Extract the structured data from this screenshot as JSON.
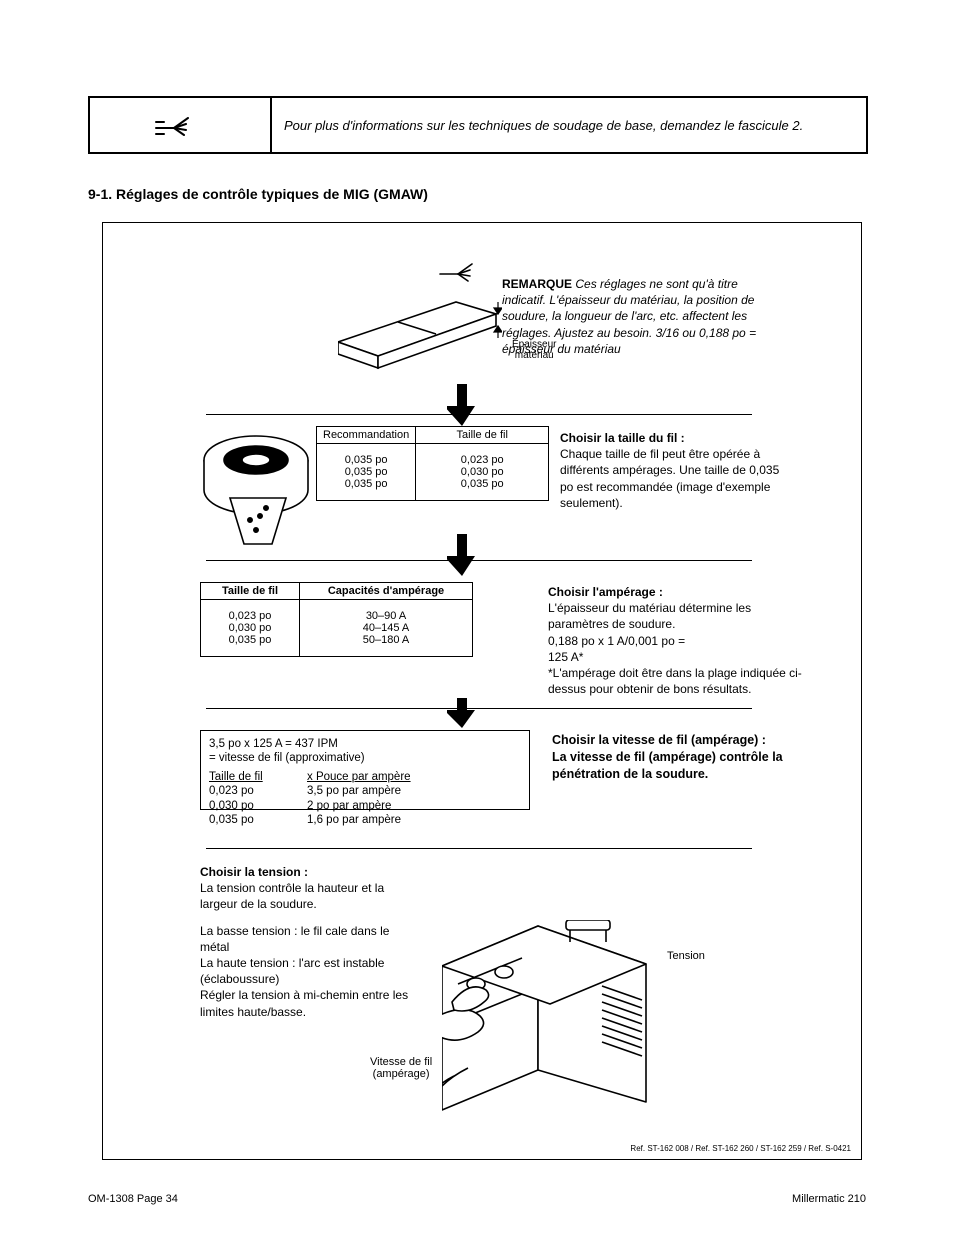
{
  "hint": {
    "hand_icon": "pointing-hand-icon",
    "text": "Pour plus d'informations sur les techniques de soudage de base, demandez le fascicule 2."
  },
  "section_title": "9-1. Réglages de contrôle typiques de MIG (GMAW)",
  "step1": {
    "note_title": "REMARQUE",
    "note_body": "Ces réglages ne sont qu'à titre indicatif. L'épaisseur du matériau, la position de soudure, la longueur de l'arc, etc. affectent les réglages. Ajustez au besoin. 3/16 ou 0,188 po = épaisseur du matériau",
    "label_thickness": "Épaisseur\nmatériau"
  },
  "step2": {
    "table": {
      "col1_header": "Recommandation",
      "col2_header": "Taille de fil",
      "col1_rows": [
        "0,035 po",
        "0,035 po",
        "0,035 po"
      ],
      "col2_rows": [
        "0,023 po",
        "0,030 po",
        "0,035 po"
      ]
    },
    "text_title": "Choisir la taille du fil   :",
    "text_body": "Chaque taille de fil peut être opérée à différents ampérages. Une taille de 0,035 po est recommandée (image d'exemple seulement)."
  },
  "step3": {
    "table": {
      "col1_header": "Taille de fil",
      "col2_header": "Capacités d'ampérage",
      "col1_rows": [
        "0,023 po",
        "0,030 po",
        "0,035 po"
      ],
      "col2_rows": [
        "30–90 A",
        "40–145 A",
        "50–180 A"
      ]
    },
    "text_title": "Choisir l'ampérage   :",
    "text_body": "L'épaisseur du matériau détermine les paramètres de soudure.\n0,188 po    x 1 A/0,001 po =\n125 A*\n*L'ampérage doit être dans la plage indiquée ci-dessus pour obtenir de bons résultats."
  },
  "step4": {
    "box_line1": "3,5 po x 125 A = 437 IPM",
    "box_line2": "= vitesse de fil (approximative)",
    "box_line3_label": "Taille de fil",
    "box_line3_r1": "0,023 po",
    "box_line3_r2": "0,030 po",
    "box_line3_r3": "0,035 po",
    "box_line4_label": "x Pouce par ampère",
    "box_line4_r1": "3,5 po par ampère",
    "box_line4_r2": "2 po par ampère",
    "box_line4_r3": "1,6 po par ampère",
    "text": "Choisir la vitesse de fil (ampérage)  :\nLa vitesse de fil (ampérage) contrôle la pénétration de la soudure."
  },
  "step5": {
    "left": "La basse tension   : le fil cale dans le métal\nLa haute tension   : l'arc est instable (éclaboussure)\nRégler la tension à mi-chemin entre les limites haute/basse.",
    "title": "Choisir la tension   :",
    "body": "La tension contrôle la hauteur et la largeur de la soudure.",
    "label_wirespeed": "Vitesse de fil\n(ampérage)",
    "label_voltage": "Tension"
  },
  "refs": "Ref. ST-162 008 / Ref. ST-162 260 /\nST-162 259 / Ref. S-0421",
  "footer": {
    "left": "OM-1308 Page 34",
    "right": "Millermatic 210"
  }
}
